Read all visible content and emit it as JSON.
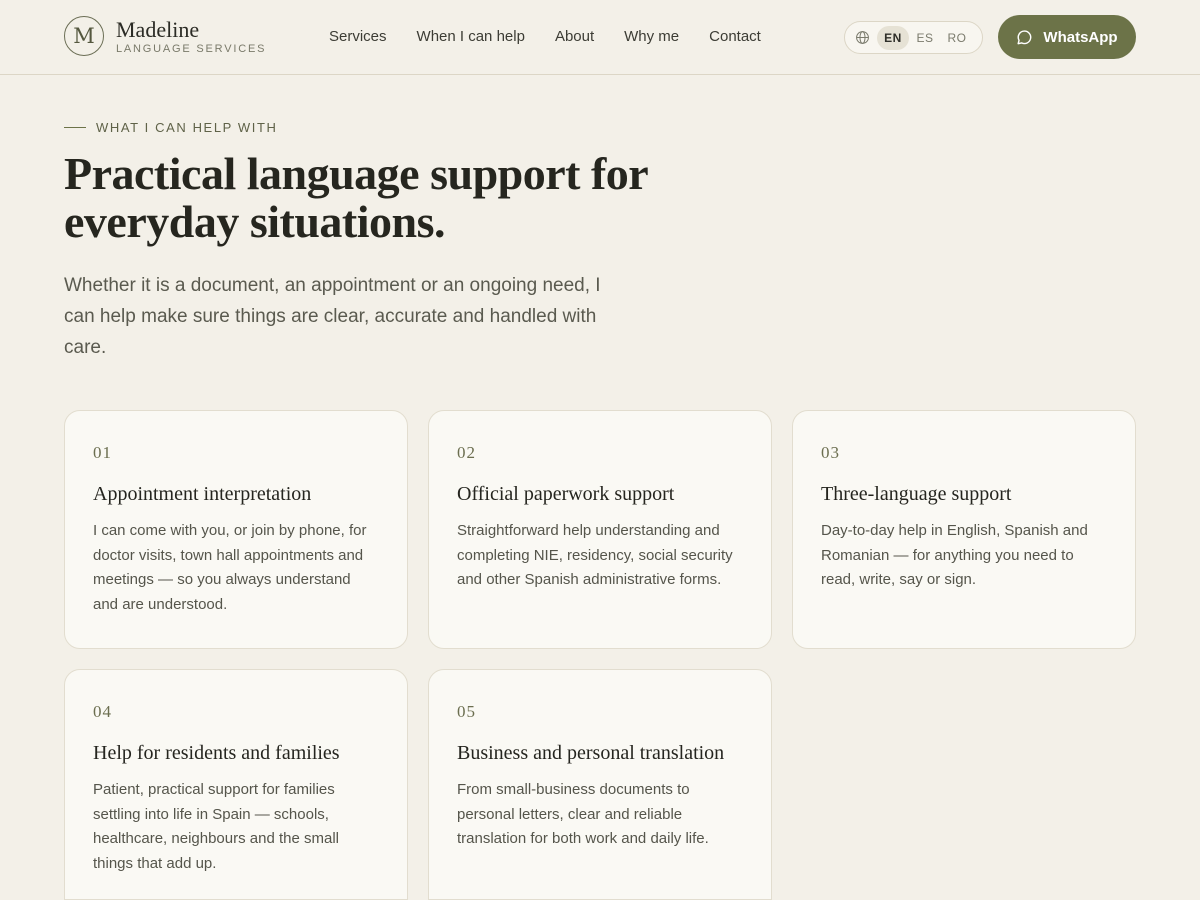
{
  "brand": {
    "monogram": "M",
    "name": "Madeline",
    "tagline": "LANGUAGE SERVICES"
  },
  "nav": {
    "items": [
      "Services",
      "When I can help",
      "About",
      "Why me",
      "Contact"
    ]
  },
  "language": {
    "icon": "globe-icon",
    "options": [
      "EN",
      "ES",
      "RO"
    ],
    "selected": "EN"
  },
  "cta": {
    "label": "WhatsApp",
    "icon": "chat-bubble-icon",
    "color": "#6c7348"
  },
  "hero": {
    "eyebrow": "WHAT I CAN HELP WITH",
    "title": "Practical language support for everyday situations.",
    "subtitle": "Whether it is a document, an appointment or an ongoing need, I can help make sure things are clear, accurate and handled with care."
  },
  "services": [
    {
      "number": "01",
      "title": "Appointment interpretation",
      "description": "I can come with you, or join by phone, for doctor visits, town hall appointments and meetings — so you always understand and are understood."
    },
    {
      "number": "02",
      "title": "Official paperwork support",
      "description": "Straightforward help understanding and completing NIE, residency, social security and other Spanish administrative forms."
    },
    {
      "number": "03",
      "title": "Three-language support",
      "description": "Day-to-day help in English, Spanish and Romanian — for anything you need to read, write, say or sign."
    },
    {
      "number": "04",
      "title": "Help for residents and families",
      "description": "Patient, practical support for families settling into life in Spain — schools, healthcare, neighbours and the small things that add up."
    },
    {
      "number": "05",
      "title": "Business and personal translation",
      "description": "From small-business documents to personal letters, clear and reliable translation for both work and daily life."
    }
  ],
  "theme": {
    "background": "#f3f0e8",
    "accent": "#6c7348",
    "card_background": "#faf9f4"
  }
}
